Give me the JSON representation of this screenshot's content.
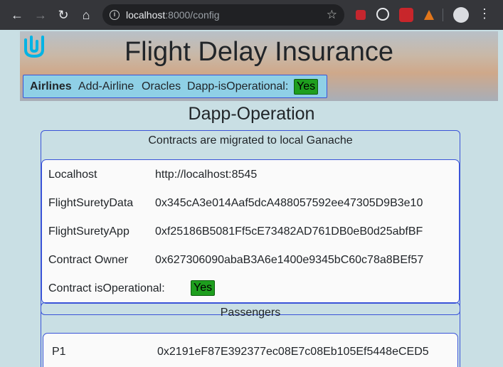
{
  "browser": {
    "url_host": "localhost",
    "url_path": ":8000/config",
    "nav_icons": [
      "back-icon",
      "forward-icon",
      "reload-icon",
      "home-icon"
    ],
    "extension_icons": [
      "ublock-icon",
      "speed-icon",
      "extension-icon",
      "metamask-icon"
    ]
  },
  "header": {
    "title": "Flight Delay Insurance",
    "nav": {
      "brand": "Airlines",
      "add_airline": "Add-Airline",
      "oracles": "Oracles",
      "operational_label": "Dapp-isOperational:",
      "operational_value": "Yes"
    }
  },
  "page": {
    "heading": "Dapp-Operation"
  },
  "contracts": {
    "title": "Contracts are migrated to local Ganache",
    "rows": [
      {
        "label": "Localhost",
        "value": "http://localhost:8545"
      },
      {
        "label": "FlightSuretyData",
        "value": "0x345cA3e014Aaf5dcA488057592ee47305D9B3e10"
      },
      {
        "label": "FlightSuretyApp",
        "value": "0xf25186B5081Ff5cE73482AD761DB0eB0d25abfBF"
      },
      {
        "label": "Contract Owner",
        "value": "0x627306090abaB3A6e1400e9345bC60c78a8BEf57"
      }
    ],
    "operational_label": "Contract isOperational:",
    "operational_value": "Yes"
  },
  "passengers": {
    "title": "Passengers",
    "rows": [
      {
        "label": "P1",
        "value": "0x2191eF87E392377ec08E7c08Eb105Ef5448eCED5"
      }
    ]
  },
  "colors": {
    "accent_border": "#3a53d8",
    "yes_badge": "#1e9e1e",
    "page_bg": "#c9dfe4",
    "nav_bg": "#8fd0e6"
  }
}
